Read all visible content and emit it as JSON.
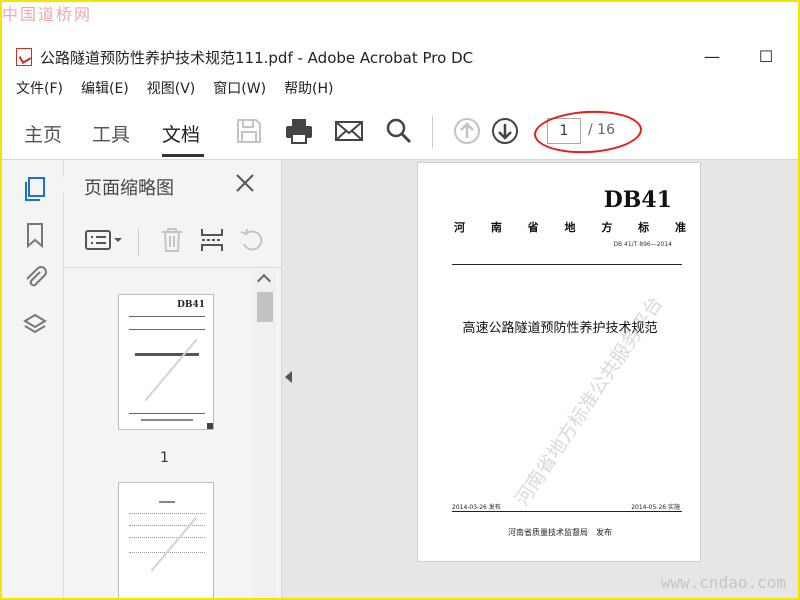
{
  "watermarks": {
    "top": "中国道桥网",
    "bottom": "www.cndao.com"
  },
  "title_bar": {
    "title": "公路隧道预防性养护技术规范111.pdf - Adobe Acrobat Pro DC",
    "minimize": "—",
    "maximize": "☐"
  },
  "menu": [
    {
      "label": "文件(F)"
    },
    {
      "label": "编辑(E)"
    },
    {
      "label": "视图(V)"
    },
    {
      "label": "窗口(W)"
    },
    {
      "label": "帮助(H)"
    }
  ],
  "toolbar": {
    "tabs": [
      {
        "label": "主页"
      },
      {
        "label": "工具"
      },
      {
        "label": "文档",
        "active": true
      }
    ],
    "icons": [
      "save-icon",
      "print-icon",
      "email-icon",
      "search-icon",
      "previous-page-icon",
      "next-page-icon"
    ],
    "page_current": "1",
    "page_total": "/ 16",
    "annotation_color": "#e0201c"
  },
  "left_rail": {
    "icons": [
      "page-thumbnails-icon",
      "bookmarks-icon",
      "attachments-icon",
      "layers-icon"
    ],
    "accent": "#1a73c9"
  },
  "thumbnail_panel": {
    "title": "页面缩略图",
    "tool_icons": [
      "options-menu-icon",
      "delete-icon",
      "extract-icon",
      "rotate-icon"
    ],
    "thumbnails": [
      {
        "page_label": "1",
        "code": "DB41"
      }
    ]
  },
  "document_page": {
    "code": "DB41",
    "org_chars": [
      "河",
      "南",
      "省",
      "地",
      "方",
      "标",
      "准"
    ],
    "standard_number": "DB 41/T 896—2014",
    "title": "高速公路隧道预防性养护技术规范",
    "release_date": "2014-03-26 发布",
    "implement_date": "2014-05-26 实施",
    "issuer": "河南省质量技术监督局　发布",
    "watermark": "河南省地方标准公共服务平台"
  }
}
